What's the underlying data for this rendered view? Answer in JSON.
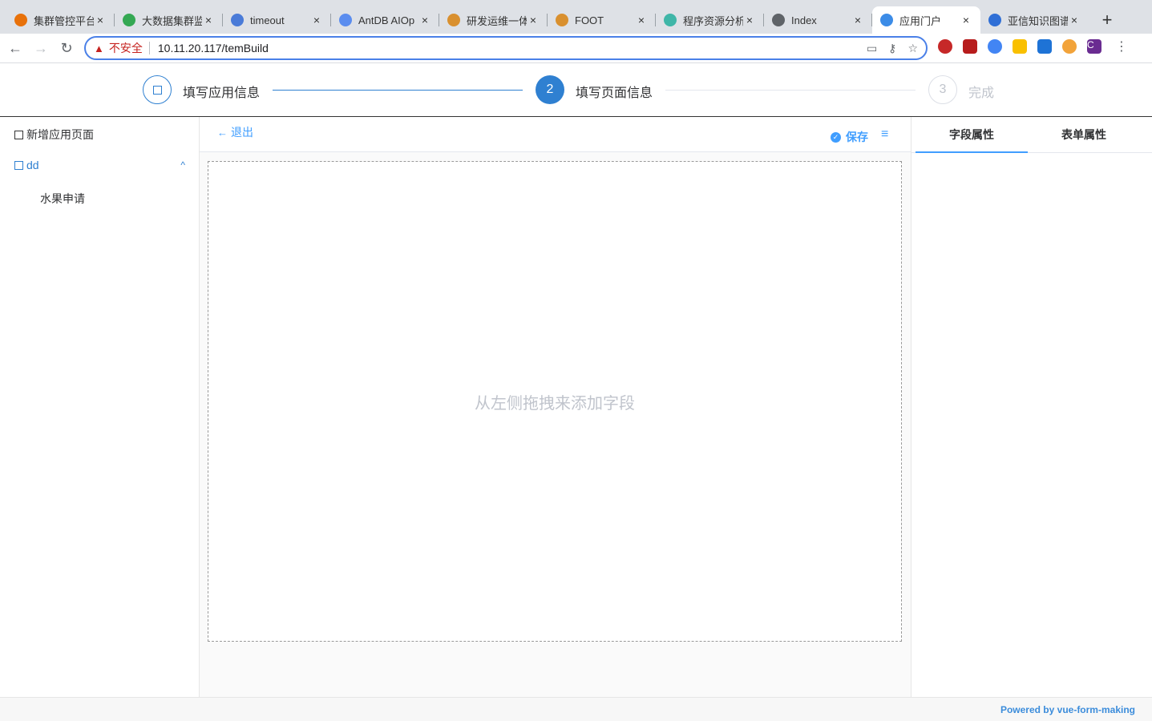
{
  "browser": {
    "tabs": [
      {
        "title": "集群管控平台",
        "color": "#e8710a"
      },
      {
        "title": "大数据集群监",
        "color": "#34a853"
      },
      {
        "title": "timeout",
        "color": "#4a7bd8"
      },
      {
        "title": "AntDB AIOp",
        "color": "#5b8def"
      },
      {
        "title": "研发运维一体",
        "color": "#d9902f"
      },
      {
        "title": "FOOT",
        "color": "#d9902f"
      },
      {
        "title": "程序资源分析",
        "color": "#3fb6a8"
      },
      {
        "title": "Index",
        "color": "#5f6368"
      },
      {
        "title": "应用门户",
        "color": "#3c8ce7"
      },
      {
        "title": "亚信知识图谱",
        "color": "#2f6fd6"
      }
    ],
    "active_tab_index": 8,
    "close_glyph": "×",
    "new_tab_glyph": "+",
    "back_glyph": "←",
    "forward_glyph": "→",
    "reload_glyph": "↻",
    "insecure_label": "不安全",
    "warning_glyph": "▲",
    "url": "10.11.20.117/temBuild",
    "avatar_letter": "C",
    "menu_glyph": "⋮"
  },
  "steps": [
    {
      "label": "填写应用信息",
      "marker": "",
      "state": "done"
    },
    {
      "label": "填写页面信息",
      "marker": "2",
      "state": "active"
    },
    {
      "label": "完成",
      "marker": "3",
      "state": "pending"
    }
  ],
  "sidebar": {
    "add_page_label": "新增应用页面",
    "group_label": "dd",
    "group_expand_glyph": "^",
    "pages": [
      "水果申请"
    ]
  },
  "center": {
    "exit_label": "退出",
    "save_label": "保存",
    "placeholder": "从左侧拖拽来添加字段"
  },
  "right_panel": {
    "tabs": [
      "字段属性",
      "表单属性"
    ],
    "active_tab_index": 0
  },
  "footer": {
    "powered_by": "Powered by vue-form-making"
  },
  "colors": {
    "primary": "#2f80d1",
    "link": "#409eff"
  }
}
